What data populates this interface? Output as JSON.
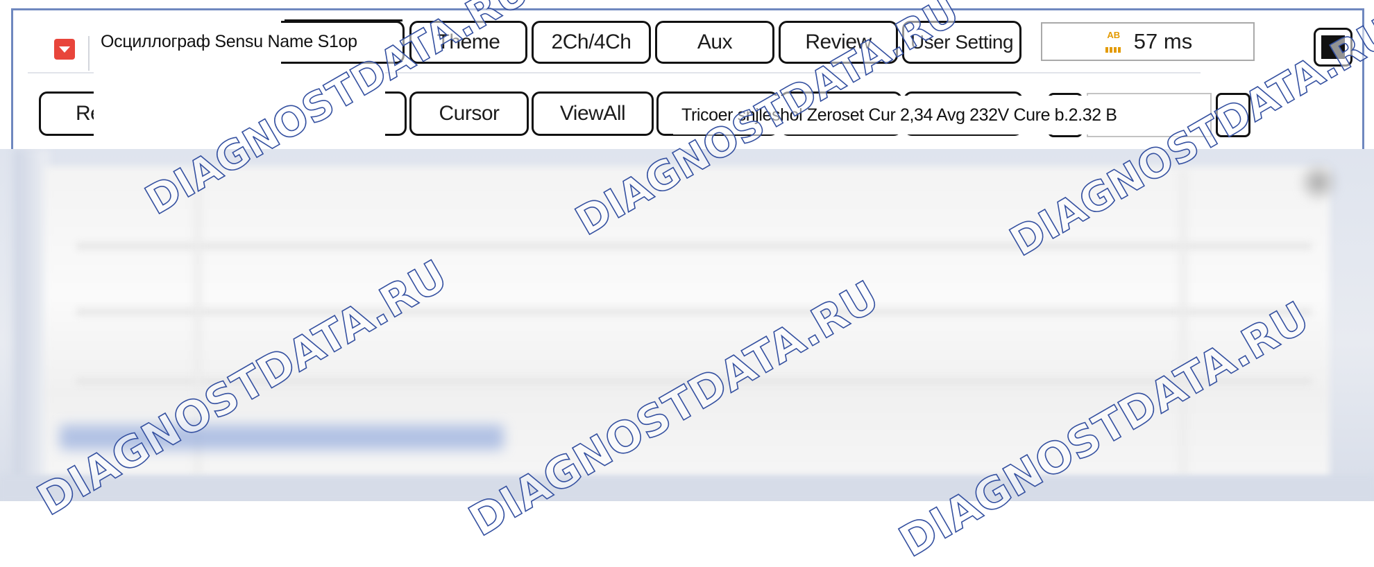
{
  "toolbar": {
    "title": "Осциллограф Sensu Name S1op",
    "row1": {
      "theme": "Theme",
      "channels": "2Ch/4Ch",
      "aux": "Aux",
      "review": "Review",
      "user_setting": "User Setting"
    },
    "timer": {
      "icon": "ab-icon",
      "value": "57 ms"
    },
    "row2": {
      "partial_button": "Re",
      "cursor": "Cursor",
      "view_all": "ViewAll",
      "readout": "Tricoer snjleshol Zeroset Cur 2,34 Avg 232V Cure b.2.32 B"
    }
  },
  "watermark": {
    "top": "DIAGNOSTDATA.RU",
    "bottom": "DIAGNOSTDATA.RU",
    "color": "#3450a0"
  },
  "colors": {
    "frame": "#6f88bf",
    "accent_icon": "#e8453b",
    "timer_icon": "#e39a00"
  }
}
